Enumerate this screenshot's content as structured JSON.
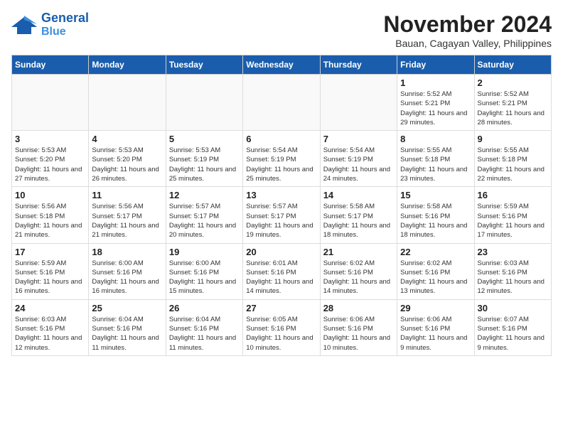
{
  "header": {
    "logo_line1": "General",
    "logo_line2": "Blue",
    "month": "November 2024",
    "location": "Bauan, Cagayan Valley, Philippines"
  },
  "weekdays": [
    "Sunday",
    "Monday",
    "Tuesday",
    "Wednesday",
    "Thursday",
    "Friday",
    "Saturday"
  ],
  "weeks": [
    [
      {
        "day": "",
        "info": ""
      },
      {
        "day": "",
        "info": ""
      },
      {
        "day": "",
        "info": ""
      },
      {
        "day": "",
        "info": ""
      },
      {
        "day": "",
        "info": ""
      },
      {
        "day": "1",
        "info": "Sunrise: 5:52 AM\nSunset: 5:21 PM\nDaylight: 11 hours and 29 minutes."
      },
      {
        "day": "2",
        "info": "Sunrise: 5:52 AM\nSunset: 5:21 PM\nDaylight: 11 hours and 28 minutes."
      }
    ],
    [
      {
        "day": "3",
        "info": "Sunrise: 5:53 AM\nSunset: 5:20 PM\nDaylight: 11 hours and 27 minutes."
      },
      {
        "day": "4",
        "info": "Sunrise: 5:53 AM\nSunset: 5:20 PM\nDaylight: 11 hours and 26 minutes."
      },
      {
        "day": "5",
        "info": "Sunrise: 5:53 AM\nSunset: 5:19 PM\nDaylight: 11 hours and 25 minutes."
      },
      {
        "day": "6",
        "info": "Sunrise: 5:54 AM\nSunset: 5:19 PM\nDaylight: 11 hours and 25 minutes."
      },
      {
        "day": "7",
        "info": "Sunrise: 5:54 AM\nSunset: 5:19 PM\nDaylight: 11 hours and 24 minutes."
      },
      {
        "day": "8",
        "info": "Sunrise: 5:55 AM\nSunset: 5:18 PM\nDaylight: 11 hours and 23 minutes."
      },
      {
        "day": "9",
        "info": "Sunrise: 5:55 AM\nSunset: 5:18 PM\nDaylight: 11 hours and 22 minutes."
      }
    ],
    [
      {
        "day": "10",
        "info": "Sunrise: 5:56 AM\nSunset: 5:18 PM\nDaylight: 11 hours and 21 minutes."
      },
      {
        "day": "11",
        "info": "Sunrise: 5:56 AM\nSunset: 5:17 PM\nDaylight: 11 hours and 21 minutes."
      },
      {
        "day": "12",
        "info": "Sunrise: 5:57 AM\nSunset: 5:17 PM\nDaylight: 11 hours and 20 minutes."
      },
      {
        "day": "13",
        "info": "Sunrise: 5:57 AM\nSunset: 5:17 PM\nDaylight: 11 hours and 19 minutes."
      },
      {
        "day": "14",
        "info": "Sunrise: 5:58 AM\nSunset: 5:17 PM\nDaylight: 11 hours and 18 minutes."
      },
      {
        "day": "15",
        "info": "Sunrise: 5:58 AM\nSunset: 5:16 PM\nDaylight: 11 hours and 18 minutes."
      },
      {
        "day": "16",
        "info": "Sunrise: 5:59 AM\nSunset: 5:16 PM\nDaylight: 11 hours and 17 minutes."
      }
    ],
    [
      {
        "day": "17",
        "info": "Sunrise: 5:59 AM\nSunset: 5:16 PM\nDaylight: 11 hours and 16 minutes."
      },
      {
        "day": "18",
        "info": "Sunrise: 6:00 AM\nSunset: 5:16 PM\nDaylight: 11 hours and 16 minutes."
      },
      {
        "day": "19",
        "info": "Sunrise: 6:00 AM\nSunset: 5:16 PM\nDaylight: 11 hours and 15 minutes."
      },
      {
        "day": "20",
        "info": "Sunrise: 6:01 AM\nSunset: 5:16 PM\nDaylight: 11 hours and 14 minutes."
      },
      {
        "day": "21",
        "info": "Sunrise: 6:02 AM\nSunset: 5:16 PM\nDaylight: 11 hours and 14 minutes."
      },
      {
        "day": "22",
        "info": "Sunrise: 6:02 AM\nSunset: 5:16 PM\nDaylight: 11 hours and 13 minutes."
      },
      {
        "day": "23",
        "info": "Sunrise: 6:03 AM\nSunset: 5:16 PM\nDaylight: 11 hours and 12 minutes."
      }
    ],
    [
      {
        "day": "24",
        "info": "Sunrise: 6:03 AM\nSunset: 5:16 PM\nDaylight: 11 hours and 12 minutes."
      },
      {
        "day": "25",
        "info": "Sunrise: 6:04 AM\nSunset: 5:16 PM\nDaylight: 11 hours and 11 minutes."
      },
      {
        "day": "26",
        "info": "Sunrise: 6:04 AM\nSunset: 5:16 PM\nDaylight: 11 hours and 11 minutes."
      },
      {
        "day": "27",
        "info": "Sunrise: 6:05 AM\nSunset: 5:16 PM\nDaylight: 11 hours and 10 minutes."
      },
      {
        "day": "28",
        "info": "Sunrise: 6:06 AM\nSunset: 5:16 PM\nDaylight: 11 hours and 10 minutes."
      },
      {
        "day": "29",
        "info": "Sunrise: 6:06 AM\nSunset: 5:16 PM\nDaylight: 11 hours and 9 minutes."
      },
      {
        "day": "30",
        "info": "Sunrise: 6:07 AM\nSunset: 5:16 PM\nDaylight: 11 hours and 9 minutes."
      }
    ]
  ]
}
